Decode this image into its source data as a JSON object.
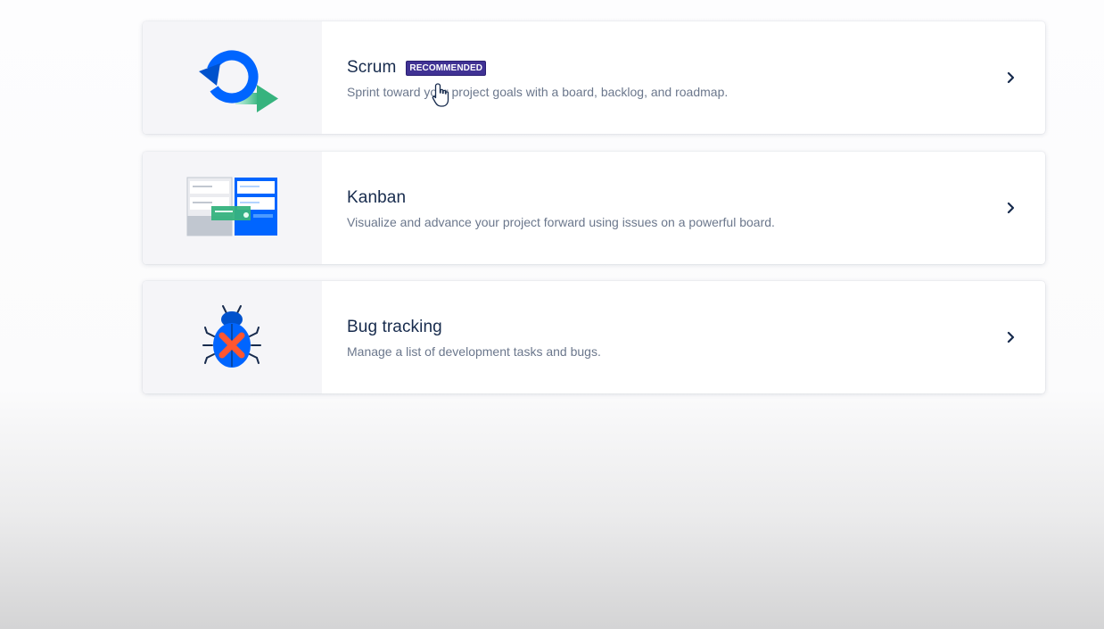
{
  "templates": [
    {
      "title": "Scrum",
      "badge": "RECOMMENDED",
      "description": "Sprint toward your project goals with a board, backlog, and roadmap.",
      "illustration": "scrum-cycle-icon"
    },
    {
      "title": "Kanban",
      "description": "Visualize and advance your project forward using issues on a powerful board.",
      "illustration": "kanban-board-icon"
    },
    {
      "title": "Bug tracking",
      "description": "Manage a list of development tasks and bugs.",
      "illustration": "bug-icon"
    }
  ],
  "icons": {
    "chevron": "chevron-right-icon",
    "cursor": "hand-pointer-cursor"
  },
  "colors": {
    "title": "#172b4d",
    "description": "#6b778c",
    "badge_bg": "#403294",
    "illustration_bg": "#f5f5f8",
    "scrum_blue": "#0065ff",
    "scrum_green": "#36b37e",
    "bug_red": "#ff5630"
  }
}
